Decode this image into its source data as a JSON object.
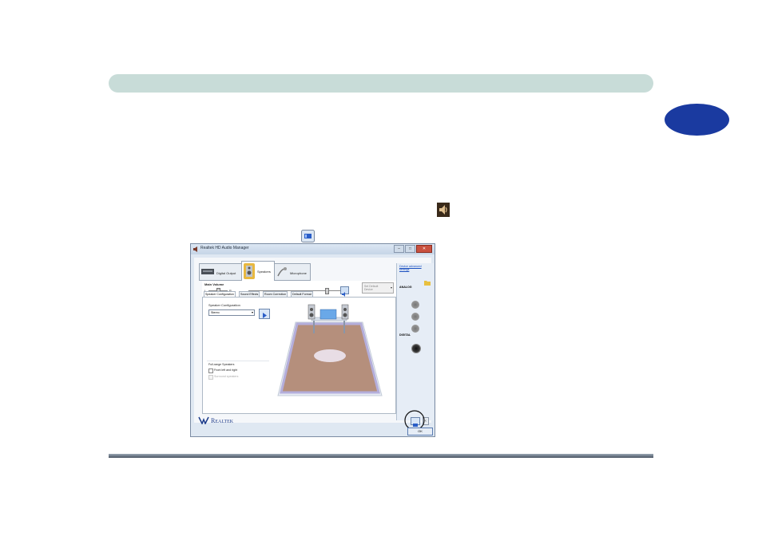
{
  "window": {
    "title": "Realtek HD Audio Manager",
    "controls": {
      "minimize": "–",
      "maximize": "□",
      "close": "✕"
    }
  },
  "device_tabs": [
    {
      "label": "Digital Output",
      "icon": "digital-output-icon"
    },
    {
      "label": "Speakers",
      "icon": "speakers-icon"
    },
    {
      "label": "Microphone",
      "icon": "microphone-icon"
    }
  ],
  "main_volume": {
    "label": "Main Volume",
    "left": "L",
    "right": "R",
    "set_default": "Set Default Device"
  },
  "sub_tabs": [
    "Speaker Configuration",
    "Sound Effects",
    "Room Correction",
    "Default Format"
  ],
  "speaker_config": {
    "label": "Speaker Configuration",
    "selected": "Stereo",
    "fullrange_label": "Full-range Speakers",
    "front": "Front left and right",
    "surround": "Surround speakers"
  },
  "side": {
    "advanced_link": "Device advanced settings",
    "analog": "ANALOG",
    "digital": "DIGITAL"
  },
  "footer": {
    "brand": "Realtek",
    "ok": "OK"
  },
  "colors": {
    "header_bar": "#c8dcd8",
    "chapter_tab": "#1a3aa0",
    "floor": "#b58f7c"
  }
}
